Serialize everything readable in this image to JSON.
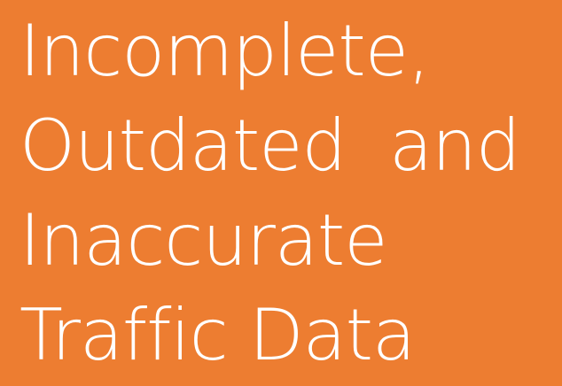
{
  "slide": {
    "background_color": "#ED7D31",
    "text_color": "#FFFFFF",
    "title_lines": [
      "Incomplete,",
      "Outdated  and",
      "Inaccurate",
      "Traffic Data"
    ]
  }
}
